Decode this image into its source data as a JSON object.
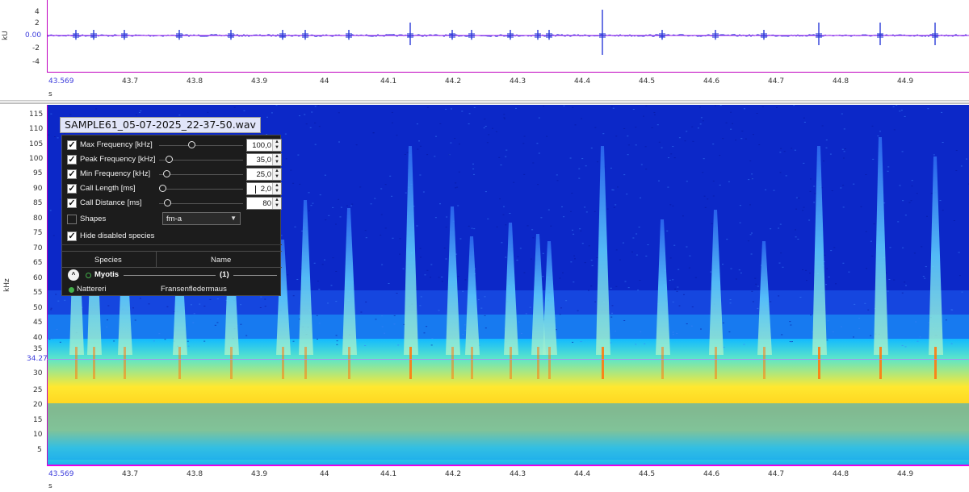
{
  "waveform": {
    "y_unit": "kU",
    "y_ticks": [
      "4",
      "2",
      "0.00",
      "-2",
      "-4"
    ],
    "x_unit": "s",
    "x_ticks": [
      "43.569",
      "43.7",
      "43.8",
      "43.9",
      "44",
      "44.1",
      "44.2",
      "44.3",
      "44.4",
      "44.5",
      "44.6",
      "44.7",
      "44.8",
      "44.9"
    ],
    "colors": {
      "signal": "#2a3ad8",
      "baseline": "#a020f0",
      "axis": "#c000c0"
    }
  },
  "spectrogram": {
    "y_unit": "kHz",
    "y_ticks": [
      "115",
      "110",
      "105",
      "100",
      "95",
      "90",
      "85",
      "80",
      "75",
      "70",
      "65",
      "60",
      "55",
      "50",
      "45",
      "40",
      "35",
      "30",
      "25",
      "20",
      "15",
      "10",
      "5"
    ],
    "cursor_value": "34.27",
    "x_unit": "s",
    "x_ticks": [
      "43.569",
      "43.7",
      "43.8",
      "43.9",
      "44",
      "44.1",
      "44.2",
      "44.3",
      "44.4",
      "44.5",
      "44.6",
      "44.7",
      "44.8",
      "44.9"
    ],
    "colors": {
      "background": "#0c28c8",
      "noise_band": "#ffe830",
      "calls": "#7fe8ff",
      "peaks": "#ff7a10"
    }
  },
  "file_title": "SAMPLE61_05-07-2025_22-37-50.wav",
  "filters": [
    {
      "label": "Max Frequency [kHz]",
      "value": "100,0",
      "checked": true
    },
    {
      "label": "Peak Frequency [kHz]",
      "value": "35,0",
      "checked": true
    },
    {
      "label": "Min Frequency [kHz]",
      "value": "25,0",
      "checked": true
    },
    {
      "label": "Call Length [ms]",
      "value": "2,0",
      "checked": true
    },
    {
      "label": "Call Distance [ms]",
      "value": "80",
      "checked": true
    }
  ],
  "shapes": {
    "label": "Shapes",
    "value": "fm-a",
    "checked": false
  },
  "hide_disabled": {
    "label": "Hide disabled species",
    "checked": true
  },
  "table": {
    "columns": [
      "Species",
      "Name"
    ],
    "group": {
      "name": "Myotis",
      "count": "(1)"
    },
    "rows": [
      {
        "species": "Nattereri",
        "name": "Fransenfledermaus"
      }
    ]
  },
  "icons": {
    "check": "check-icon",
    "spin_up": "chevron-up-icon",
    "spin_down": "chevron-down-icon",
    "dropdown": "caret-down-icon",
    "collapse": "chevron-up-circle-icon"
  }
}
